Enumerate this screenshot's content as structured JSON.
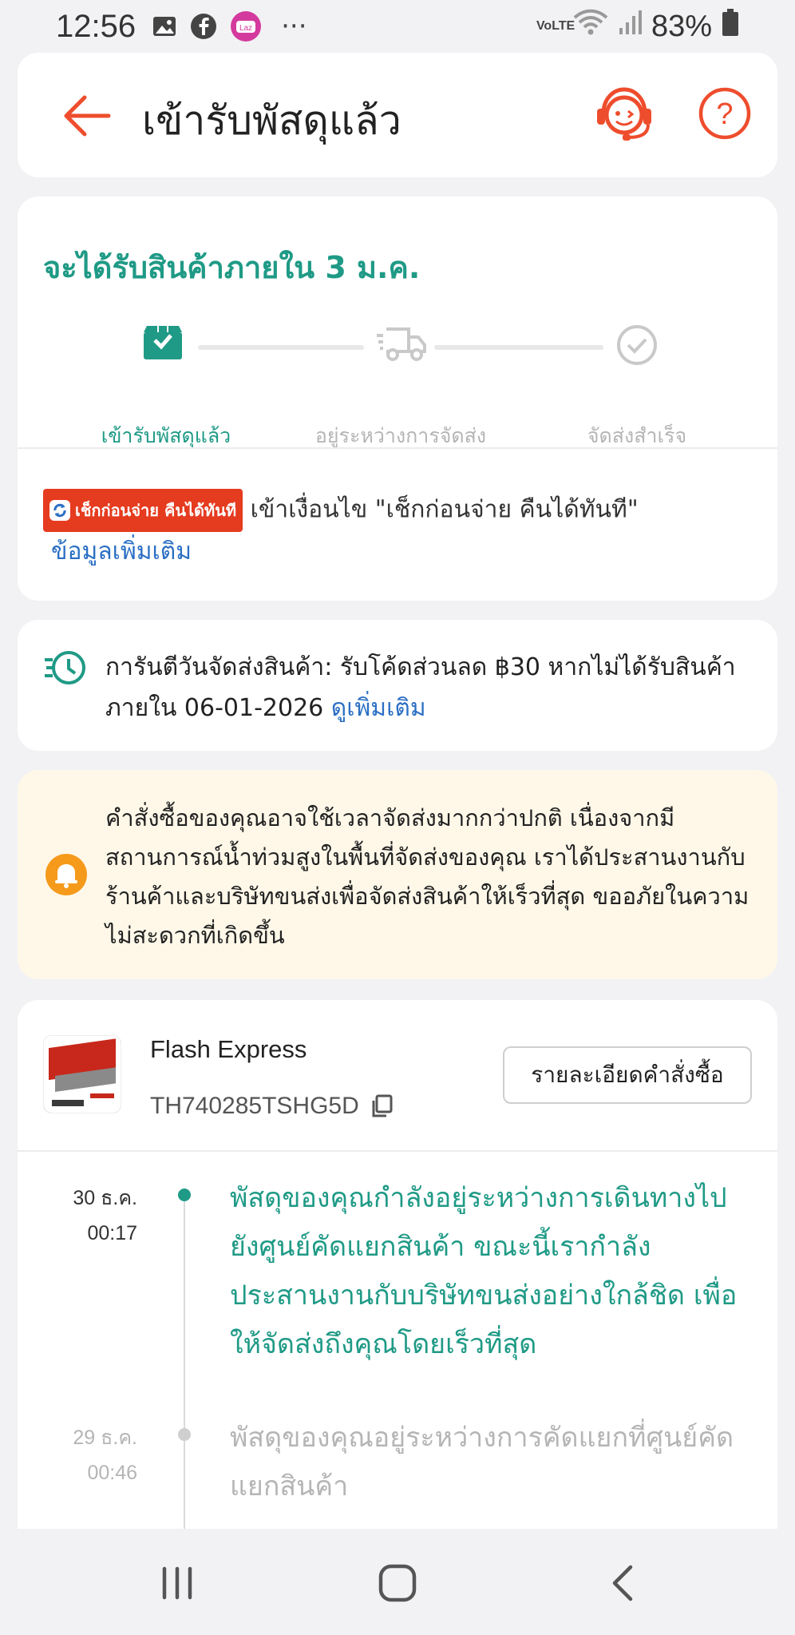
{
  "status_bar": {
    "time": "12:56",
    "battery": "83%",
    "icons": [
      "gallery-icon",
      "facebook-icon",
      "lazada-icon",
      "more-icon",
      "volte-icon",
      "wifi-icon",
      "signal-icon",
      "battery-icon"
    ],
    "more": "···",
    "volte": "VoLTE",
    "laz": "Laz"
  },
  "header": {
    "title": "เข้ารับพัสดุแล้ว",
    "help": "?"
  },
  "tracking": {
    "eta": "จะได้รับสินค้าภายใน 3 ม.ค.",
    "steps": [
      {
        "label": "เข้ารับพัสดุแล้ว",
        "state": "active",
        "icon": "box-icon"
      },
      {
        "label": "อยู่ระหว่างการจัดส่ง",
        "state": "inactive",
        "icon": "truck-icon"
      },
      {
        "label": "จัดส่งสำเร็จ",
        "state": "inactive",
        "icon": "check-circle-icon"
      }
    ],
    "cod_badge": "เช็กก่อนจ่าย คืนได้ทันที",
    "cod_text": "เข้าเงื่อนไข \"เช็กก่อนจ่าย คืนได้ทันที\"",
    "more_info": "ข้อมูลเพิ่มเติม"
  },
  "guarantee": {
    "text": "การันตีวันจัดส่งสินค้า: รับโค้ดส่วนลด ฿30 หากไม่ได้รับสินค้าภายใน 06-01-2026",
    "link": "ดูเพิ่มเติม"
  },
  "notice": {
    "text": "คำสั่งซื้อของคุณอาจใช้เวลาจัดส่งมากกว่าปกติ เนื่องจากมีสถานการณ์น้ำท่วมสูงในพื้นที่จัดส่งของคุณ เราได้ประสานงานกับร้านค้าและบริษัทขนส่งเพื่อจัดส่งสินค้าให้เร็วที่สุด ขออภัยในความไม่สะดวกที่เกิดขึ้น"
  },
  "shipment": {
    "carrier": "Flash Express",
    "tracking_no": "TH740285TSHG5D",
    "detail_button": "รายละเอียดคำสั่งซื้อ",
    "events": [
      {
        "date": "30 ธ.ค.",
        "time": "00:17",
        "text": "พัสดุของคุณกำลังอยู่ระหว่างการเดินทางไปยังศูนย์คัดแยกสินค้า ขณะนี้เรากำลังประสานงานกับบริษัทขนส่งอย่างใกล้ชิด เพื่อให้จัดส่งถึงคุณโดยเร็วที่สุด",
        "active": true
      },
      {
        "date": "29 ธ.ค.",
        "time": "00:46",
        "text": "พัสดุของคุณอยู่ระหว่างการคัดแยกที่ศูนย์คัดแยกสินค้า",
        "active": false
      }
    ]
  },
  "colors": {
    "accent_orange": "#ee4d2d",
    "teal": "#1f9a86",
    "link_blue": "#2b6fc4",
    "notice_bg": "#fff8e9",
    "muted": "#b5b5b5"
  }
}
